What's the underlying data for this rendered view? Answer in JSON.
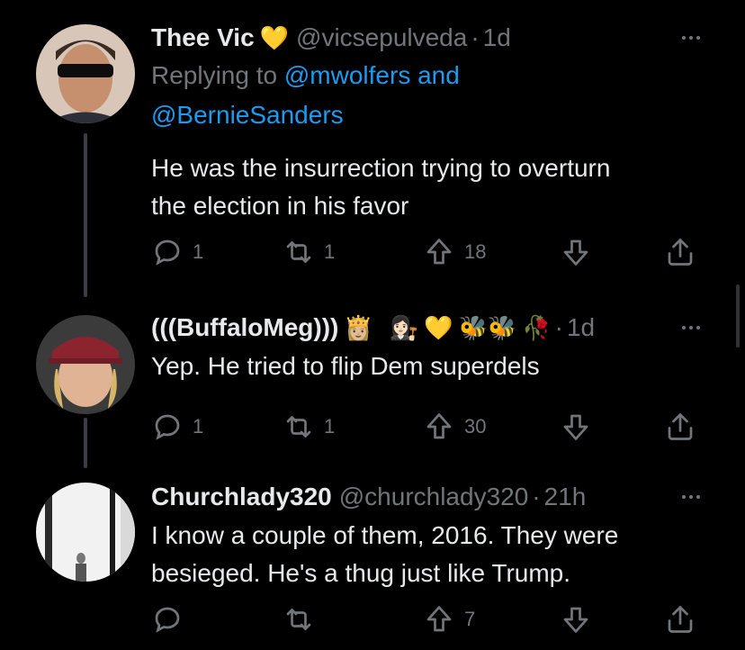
{
  "tweets": [
    {
      "name": "Thee Vic",
      "name_emoji": "💛",
      "handle": "@vicsepulveda",
      "time": "1d",
      "replying_prefix": "Replying to ",
      "replying_mention_1": "@mwolfers and",
      "replying_mention_2": "@BernieSanders",
      "text_line_1": "He was the insurrection trying to overturn",
      "text_line_2": "the election in his favor",
      "replies": "1",
      "retweets": "1",
      "upvotes": "18"
    },
    {
      "name": "(((BuffaloMeg)))",
      "name_emojis": [
        "👸🏼",
        "👩🏻‍⚖️",
        "💛",
        "🐝🐝",
        "🥀"
      ],
      "handle": "",
      "time": "1d",
      "text_line_1": "Yep. He tried to flip Dem superdels",
      "replies": "1",
      "retweets": "1",
      "upvotes": "30"
    },
    {
      "name": "Churchlady320",
      "handle": "@churchlady320",
      "time": "21h",
      "text_line_1": "I know a couple of them, 2016. They were",
      "text_line_2": "besieged. He's a thug just like Trump.",
      "replies": "",
      "retweets": "",
      "upvotes": "7"
    }
  ],
  "separator": "·",
  "colors": {
    "background": "#000000",
    "text": "#e7e9ea",
    "muted": "#71767b",
    "link": "#1d9bf0"
  }
}
